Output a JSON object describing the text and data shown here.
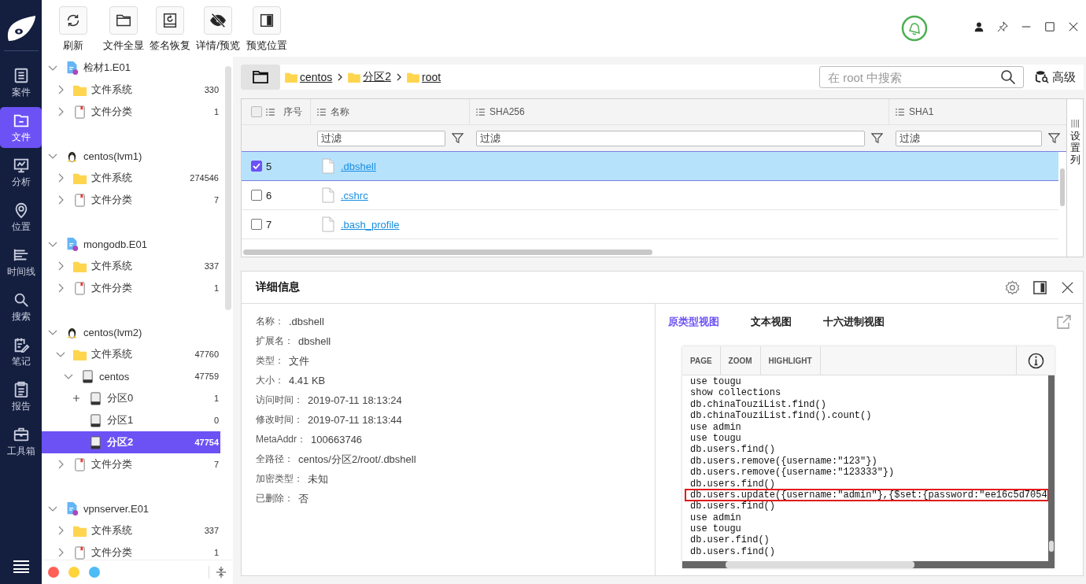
{
  "nav": {
    "items": [
      {
        "label": "案件",
        "selected": false
      },
      {
        "label": "文件",
        "selected": true
      },
      {
        "label": "分析",
        "selected": false
      },
      {
        "label": "位置",
        "selected": false
      },
      {
        "label": "时间线",
        "selected": false
      },
      {
        "label": "搜索",
        "selected": false
      },
      {
        "label": "笔记",
        "selected": false
      },
      {
        "label": "报告",
        "selected": false
      },
      {
        "label": "工具箱",
        "selected": false
      }
    ]
  },
  "toolbar": [
    "刷新",
    "文件全显",
    "签名恢复",
    "详情/预览",
    "预览位置"
  ],
  "tree": [
    {
      "label": "检材1.E01",
      "kind": "image",
      "expanded": true,
      "selected": false,
      "children": [
        {
          "label": "文件系统",
          "count": "330",
          "kind": "folder",
          "expanded": false,
          "selected": false
        },
        {
          "label": "文件分类",
          "count": "1",
          "kind": "category",
          "expanded": false,
          "selected": false
        }
      ]
    },
    {
      "label": "centos(lvm1)",
      "kind": "linux",
      "expanded": true,
      "selected": false,
      "children": [
        {
          "label": "文件系统",
          "count": "274546",
          "kind": "folder",
          "expanded": false,
          "selected": false
        },
        {
          "label": "文件分类",
          "count": "7",
          "kind": "category",
          "expanded": false,
          "selected": false
        }
      ]
    },
    {
      "label": "mongodb.E01",
      "kind": "image",
      "expanded": true,
      "selected": false,
      "children": [
        {
          "label": "文件系统",
          "count": "337",
          "kind": "folder",
          "expanded": false,
          "selected": false
        },
        {
          "label": "文件分类",
          "count": "1",
          "kind": "category",
          "expanded": false,
          "selected": false
        }
      ]
    },
    {
      "label": "centos(lvm2)",
      "kind": "linux",
      "expanded": true,
      "selected": false,
      "children": [
        {
          "label": "文件系统",
          "count": "47760",
          "kind": "folder",
          "expanded": true,
          "selected": false,
          "children": [
            {
              "label": "centos",
              "count": "47759",
              "kind": "drive",
              "expanded": true,
              "selected": false,
              "children": [
                {
                  "label": "分区0",
                  "count": "1",
                  "kind": "partition",
                  "expanded": false,
                  "selected": false
                },
                {
                  "label": "分区1",
                  "count": "0",
                  "kind": "partition",
                  "selected": false
                },
                {
                  "label": "分区2",
                  "count": "47754",
                  "kind": "partition",
                  "selected": true
                }
              ]
            }
          ]
        },
        {
          "label": "文件分类",
          "count": "7",
          "kind": "category",
          "expanded": false,
          "selected": false
        }
      ]
    },
    {
      "label": "vpnserver.E01",
      "kind": "image",
      "expanded": true,
      "selected": false,
      "children": [
        {
          "label": "文件系统",
          "count": "337",
          "kind": "folder",
          "expanded": false,
          "selected": false
        },
        {
          "label": "文件分类",
          "count": "1",
          "kind": "category",
          "expanded": false,
          "selected": false
        }
      ]
    }
  ],
  "tree_footer": {
    "dots": [
      {
        "color": "#ff5f57"
      },
      {
        "color": "#ffd43b"
      },
      {
        "color": "#4dbbf5"
      }
    ]
  },
  "breadcrumb": [
    "centos",
    "分区2",
    "root"
  ],
  "search": {
    "placeholder": "在 root 中搜索"
  },
  "advanced_button": "高级",
  "table": {
    "select_all": false,
    "columns": [
      {
        "label": "序号"
      },
      {
        "label": "名称",
        "filter_placeholder": "过滤"
      },
      {
        "label": "SHA256",
        "filter_placeholder": "过滤"
      },
      {
        "label": "SHA1",
        "filter_placeholder": "过滤"
      }
    ],
    "settings_label": "设置列",
    "rows": [
      {
        "index": "5",
        "name": ".dbshell",
        "checked": true,
        "selected": true
      },
      {
        "index": "6",
        "name": ".cshrc",
        "checked": false,
        "selected": false
      },
      {
        "index": "7",
        "name": ".bash_profile",
        "checked": false,
        "selected": false
      }
    ]
  },
  "details": {
    "title": "详细信息",
    "fields": [
      {
        "label": "名称：",
        "value": ".dbshell"
      },
      {
        "label": "扩展名：",
        "value": "dbshell"
      },
      {
        "label": "类型：",
        "value": "文件"
      },
      {
        "label": "大小：",
        "value": "4.41 KB"
      },
      {
        "label": "访问时间：",
        "value": "2019-07-11 18:13:24"
      },
      {
        "label": "修改时间：",
        "value": "2019-07-11 18:13:44"
      },
      {
        "label": "MetaAddr：",
        "value": "100663746"
      },
      {
        "label": "全路径：",
        "value": "centos/分区2/root/.dbshell"
      },
      {
        "label": "加密类型：",
        "value": "未知"
      },
      {
        "label": "已删除：",
        "value": "否"
      }
    ]
  },
  "preview": {
    "tabs": [
      {
        "label": "原类型视图",
        "selected": true
      },
      {
        "label": "文本视图",
        "selected": false
      },
      {
        "label": "十六进制视图",
        "selected": false
      }
    ],
    "viewer_tabs": [
      "PAGE",
      "ZOOM",
      "HIGHLIGHT"
    ],
    "lines": [
      {
        "text": "use tougu",
        "highlighted": false
      },
      {
        "text": "show collections",
        "highlighted": false
      },
      {
        "text": "db.chinaTouziList.find()",
        "highlighted": false
      },
      {
        "text": "db.chinaTouziList.find().count()",
        "highlighted": false
      },
      {
        "text": "use admin",
        "highlighted": false
      },
      {
        "text": "use tougu",
        "highlighted": false
      },
      {
        "text": "db.users.find()",
        "highlighted": false
      },
      {
        "text": "db.users.remove({username:\"123\"})",
        "highlighted": false
      },
      {
        "text": "db.users.remove({username:\"123333\"})",
        "highlighted": false
      },
      {
        "text": "db.users.find()",
        "highlighted": false
      },
      {
        "text": "db.users.update({username:\"admin\"},{$set:{password:\"ee16c5d7054",
        "highlighted": true
      },
      {
        "text": "db.users.find()",
        "highlighted": false
      },
      {
        "text": "use admin",
        "highlighted": false
      },
      {
        "text": "use tougu",
        "highlighted": false
      },
      {
        "text": "db.user.find()",
        "highlighted": false
      },
      {
        "text": "db.users.find()",
        "highlighted": false
      }
    ]
  }
}
